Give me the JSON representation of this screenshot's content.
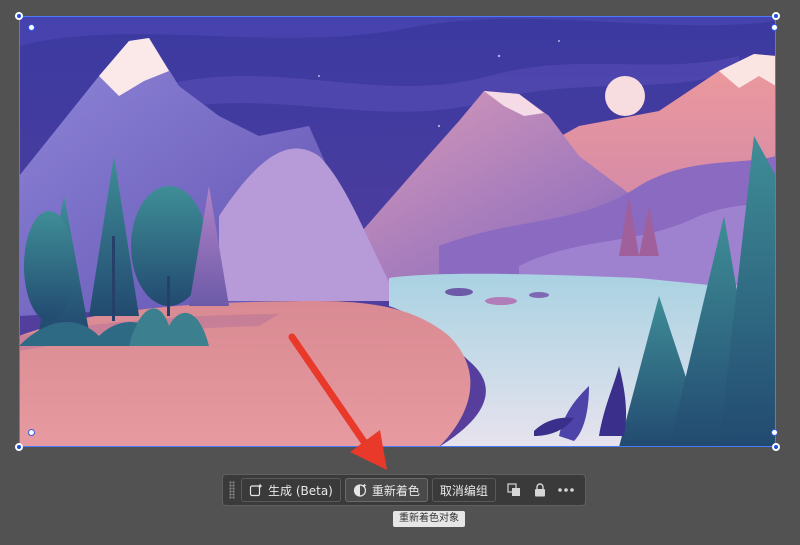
{
  "canvas": {
    "background": "#525252",
    "selection_color": "#4a7bff",
    "artwork": "mountain-lake-night-illustration",
    "annotation_arrow_color": "#e8392a"
  },
  "task_bar": {
    "generate_label": "生成 (Beta)",
    "recolor_label": "重新着色",
    "ungroup_label": "取消编组",
    "icons": [
      "generate-icon",
      "recolor-icon",
      "arrange-icon",
      "lock-icon",
      "more-icon"
    ]
  },
  "tooltip": {
    "text": "重新着色对象"
  }
}
